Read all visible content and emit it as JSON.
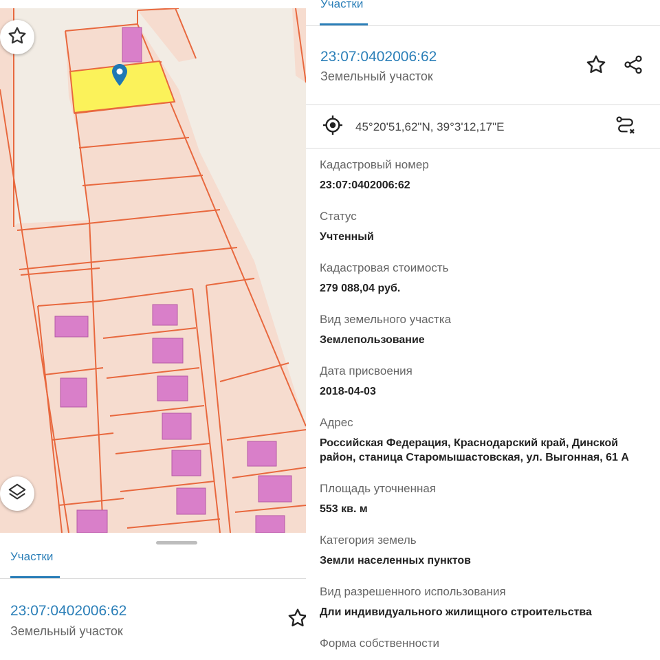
{
  "tabs": {
    "parcels_label": "Участки"
  },
  "parcel": {
    "cadastral_number": "23:07:0402006:62",
    "type": "Земельный участок",
    "coordinates": "45°20'51,62\"N, 39°3'12,17\"E"
  },
  "fields": [
    {
      "label": "Кадастровый номер",
      "value": "23:07:0402006:62"
    },
    {
      "label": "Статус",
      "value": "Учтенный"
    },
    {
      "label": "Кадастровая стоимость",
      "value": "279 088,04 руб."
    },
    {
      "label": "Вид земельного участка",
      "value": "Землепользование"
    },
    {
      "label": "Дата присвоения",
      "value": "2018-04-03"
    },
    {
      "label": "Адрес",
      "value": "Российская Федерация, Краснодарский край, Динской район, станица Старомышастовская, ул. Выгонная, 61 А"
    },
    {
      "label": "Площадь уточненная",
      "value": "553 кв. м"
    },
    {
      "label": "Категория земель",
      "value": "Земли населенных пунктов"
    },
    {
      "label": "Вид разрешенного использования",
      "value": "Дли индивидуального жилищного строительства"
    },
    {
      "label": "Форма собственности",
      "value": ""
    }
  ],
  "icons": {
    "favorite": "star-icon",
    "share": "share-icon",
    "locate": "crosshair-icon",
    "route": "route-icon",
    "layers": "layers-icon",
    "marker": "map-pin-icon"
  },
  "colors": {
    "accent": "#2b7fb8",
    "parcel_line": "#e8683e",
    "parcel_fill": "#f6dccf",
    "building_fill": "#d97fc9",
    "selected_fill": "#fbf25a"
  }
}
